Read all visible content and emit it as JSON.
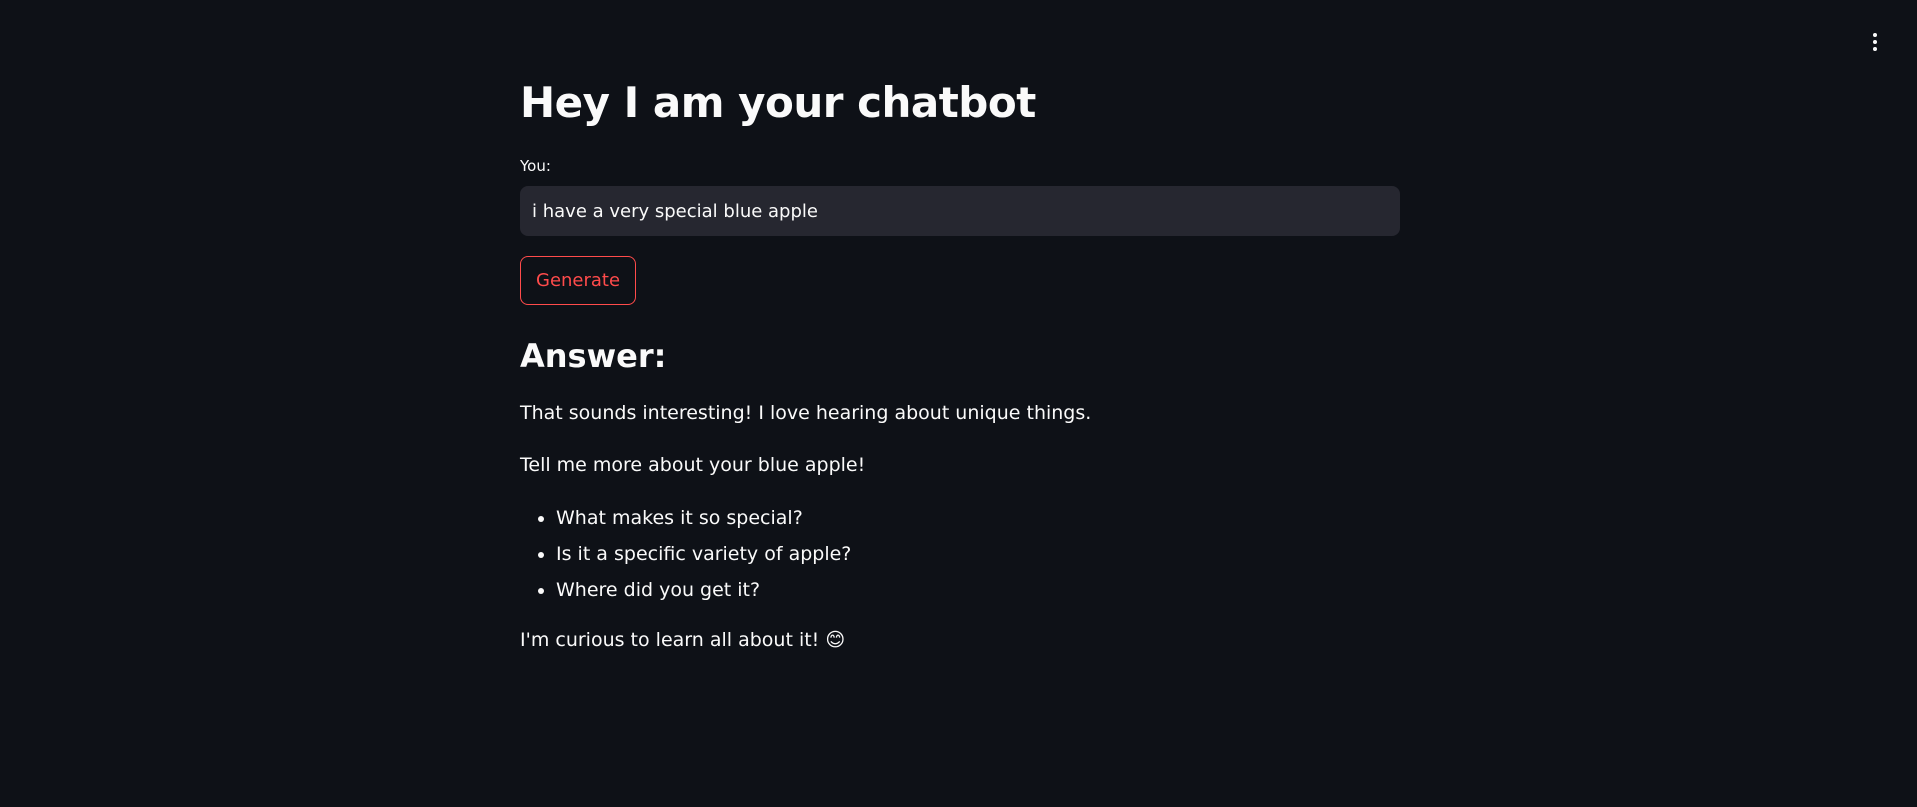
{
  "header": {
    "menu_icon": "vertical-dots-icon"
  },
  "main": {
    "title": "Hey I am your chatbot",
    "input": {
      "label": "You:",
      "value": "i have a very special blue apple"
    },
    "generate_button": "Generate",
    "answer": {
      "heading": "Answer:",
      "paragraph1": "That sounds interesting! I love hearing about unique things.",
      "paragraph2": "Tell me more about your blue apple!",
      "list": [
        "What makes it so special?",
        "Is it a specific variety of apple?",
        "Where did you get it?"
      ],
      "paragraph3": "I'm curious to learn all about it! 😊"
    }
  },
  "colors": {
    "background": "#0e1117",
    "text": "#fafafa",
    "input_background": "#262730",
    "accent": "#ff4b4b"
  }
}
